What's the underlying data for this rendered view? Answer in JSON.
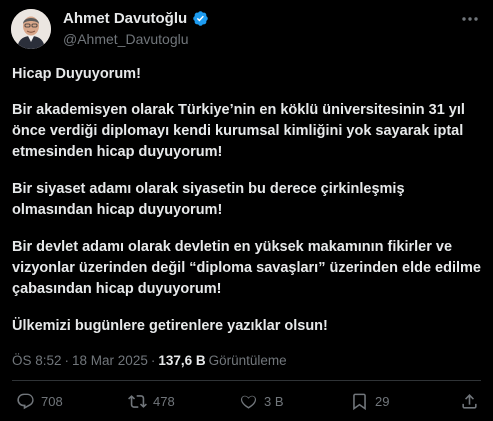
{
  "author": {
    "display_name": "Ahmet Davutoğlu",
    "handle": "@Ahmet_Davutoglu"
  },
  "post": {
    "title": "Hicap Duyuyorum!",
    "paragraph1": "Bir akademisyen olarak Türkiye’nin en köklü üniversitesinin 31 yıl önce verdiği diplomayı kendi kurumsal kimliğini yok sayarak iptal etmesinden hicap duyuyorum!",
    "paragraph2": "Bir siyaset adamı olarak siyasetin bu derece çirkinleşmiş olmasından hicap duyuyorum!",
    "paragraph3_before": "Bir devlet adamı olarak devletin en yüksek makamının fikirler ve vizyonlar üzerinden değil ",
    "paragraph3_quote": "“diploma savaşları”",
    "paragraph3_after": " üzerinden elde edilme çabasından hicap duyuyorum!",
    "paragraph4": "Ülkemizi bugünlere getirenlere yazıklar olsun!"
  },
  "meta": {
    "time": "ÖS 8:52",
    "separator": "·",
    "date": "18 Mar 2025",
    "views_count": "137,6 B",
    "views_label": "Görüntüleme"
  },
  "actions": {
    "replies": "708",
    "reposts": "478",
    "likes": "3 B",
    "bookmarks": "29"
  },
  "colors": {
    "background": "#000000",
    "text": "#e7e9ea",
    "muted": "#71767b",
    "verified": "#1d9bf0"
  }
}
